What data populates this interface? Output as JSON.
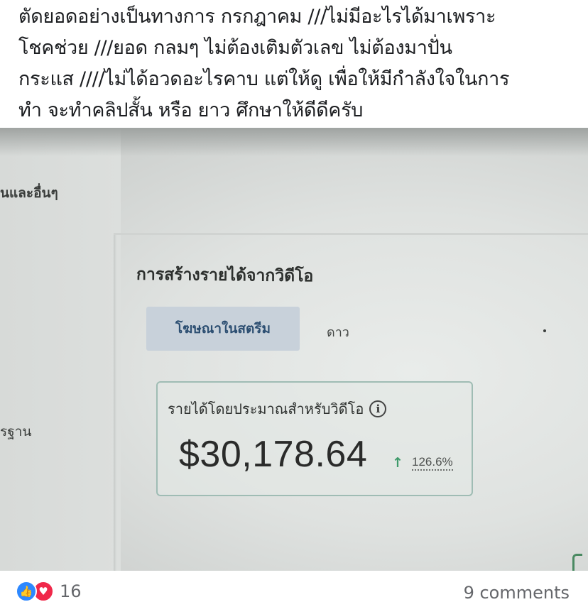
{
  "post": {
    "text_lines": [
      "ตัดยอดอย่างเป็นทางการ กรกฎาคม   ///ไม่มีอะไรได้มาเพราะ",
      "โชคช่วย  ///ยอด กลมๆ   ไม่ต้องเติมตัวเลข ไม่ต้องมาปั่น",
      "กระแส ////ไม่ได้อวดอะไรคาบ   แต่ให้ดู เพื่อให้มีกำลังใจในการ",
      "ทำ     จะทำคลิปสั้น หรือ ยาว ศึกษาให้ดีดีครับ"
    ]
  },
  "photo": {
    "left_labels": [
      "นและอื่นๆ",
      "รฐาน"
    ],
    "section_title": "การสร้างรายได้จากวิดีโอ",
    "tabs": [
      {
        "label": "โฆษณาในสตรีม",
        "active": true
      },
      {
        "label": "ดาว",
        "active": false
      }
    ],
    "card": {
      "title": "รายได้โดยประมาณสำหรับวิดีโอ",
      "info_icon": "info-circle-icon",
      "amount": "$30,178.64",
      "trend_icon": "arrow-up-icon",
      "trend_symbol": "↑",
      "change": "126.6%"
    }
  },
  "footer": {
    "reaction_icons": [
      "like-icon",
      "love-icon"
    ],
    "reaction_count": "16",
    "comments": "9 comments"
  },
  "colors": {
    "like": "#2d88ff",
    "love": "#f0284a",
    "tab_active_bg": "#c8d1da",
    "tab_active_text": "#2d4f72",
    "trend_up": "#3e9a6a",
    "card_border": "#9fbcb4"
  }
}
